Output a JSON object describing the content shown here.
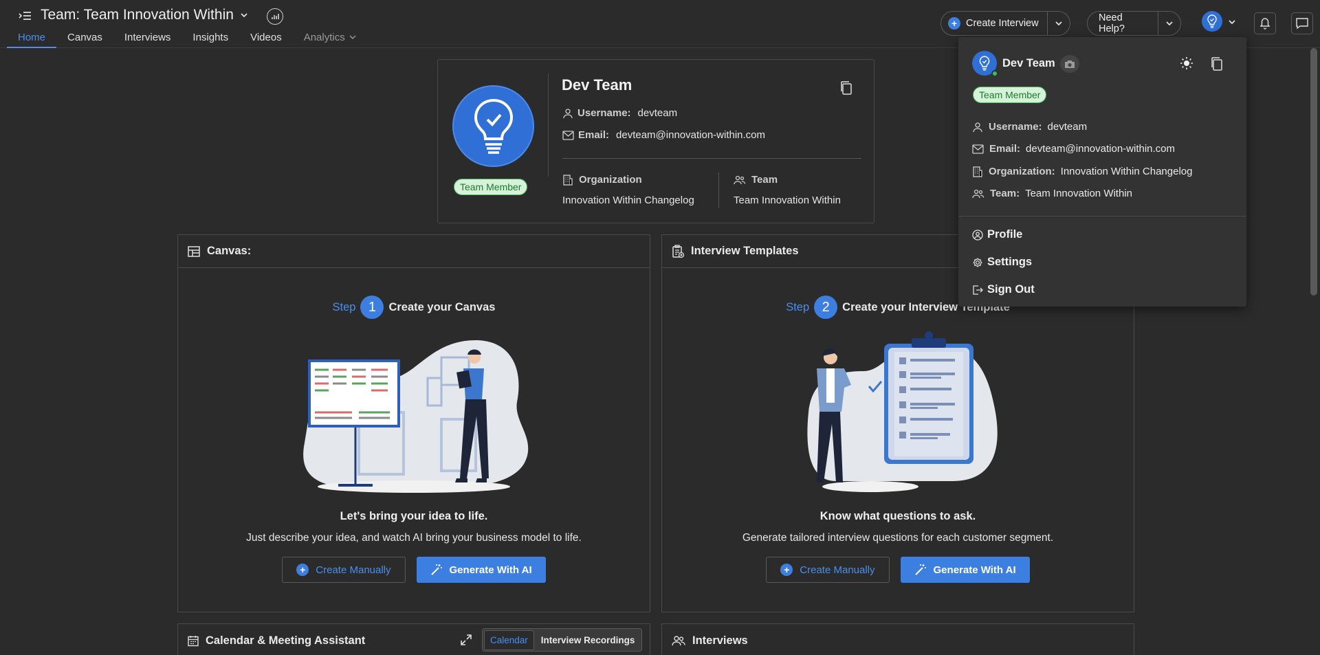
{
  "header": {
    "team_title": "Team: Team Innovation Within",
    "nav": [
      {
        "label": "Home",
        "active": true
      },
      {
        "label": "Canvas"
      },
      {
        "label": "Interviews"
      },
      {
        "label": "Insights"
      },
      {
        "label": "Videos"
      },
      {
        "label": "Analytics",
        "disabled": true
      }
    ],
    "create_interview": "Create Interview",
    "need_help": "Need Help?"
  },
  "profile_card": {
    "name": "Dev Team",
    "badge": "Team Member",
    "username_label": "Username:",
    "username": "devteam",
    "email_label": "Email:",
    "email": "devteam@innovation-within.com",
    "organization_label": "Organization",
    "organization": "Innovation Within Changelog",
    "team_label": "Team",
    "team": "Team Innovation Within"
  },
  "canvas_panel": {
    "title": "Canvas:",
    "step_word": "Step",
    "step_num": "1",
    "step_text": "Create your Canvas",
    "tagline": "Let's bring your idea to life.",
    "description": "Just describe your idea, and watch AI bring your business model to life.",
    "btn_manual": "Create Manually",
    "btn_ai": "Generate With AI"
  },
  "templates_panel": {
    "title": "Interview Templates",
    "step_word": "Step",
    "step_num": "2",
    "step_text": "Create your Interview Template",
    "tagline": "Know what questions to ask.",
    "description": "Generate tailored interview questions for each customer segment.",
    "btn_manual": "Create Manually",
    "btn_ai": "Generate With AI"
  },
  "calendar_panel": {
    "title": "Calendar & Meeting Assistant",
    "tab_calendar": "Calendar",
    "tab_recordings": "Interview Recordings"
  },
  "interviews_panel": {
    "title": "Interviews"
  },
  "dropdown": {
    "name": "Dev Team",
    "badge": "Team Member",
    "username_label": "Username:",
    "username": "devteam",
    "email_label": "Email:",
    "email": "devteam@innovation-within.com",
    "organization_label": "Organization:",
    "organization": "Innovation Within Changelog",
    "team_label": "Team:",
    "team": "Team Innovation Within",
    "menu": {
      "profile": "Profile",
      "settings": "Settings",
      "sign_out": "Sign Out"
    }
  },
  "colors": {
    "background": "#2b2b2b",
    "accent": "#3d7fe0",
    "badge_bg": "#d6f2d9",
    "badge_text": "#1d7a2e",
    "online": "#35c25a"
  },
  "icons": [
    "menu-icon",
    "chevron-down-icon",
    "analytics-icon",
    "plus-circle-icon",
    "lightbulb-icon",
    "bell-icon",
    "chat-icon",
    "copy-icon",
    "user-icon",
    "mail-icon",
    "building-icon",
    "team-icon",
    "board-icon",
    "clipboard-icon",
    "magic-wand-icon",
    "calendar-icon",
    "expand-icon",
    "camera-icon",
    "sun-icon",
    "profile-icon",
    "gear-icon",
    "sign-out-icon"
  ]
}
